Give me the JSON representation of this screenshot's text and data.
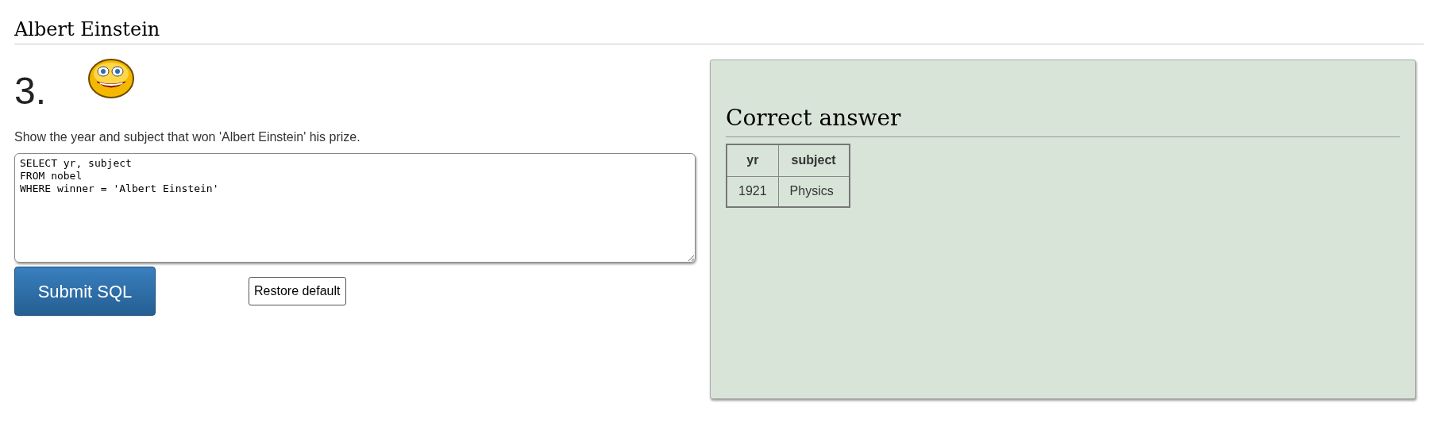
{
  "page_title": "Albert Einstein",
  "question": {
    "number": "3.",
    "text": "Show the year and subject that won 'Albert Einstein' his prize."
  },
  "sql_editor": {
    "value": "SELECT yr, subject\nFROM nobel\nWHERE winner = 'Albert Einstein'"
  },
  "buttons": {
    "submit": "Submit SQL",
    "restore": "Restore default"
  },
  "answer_panel": {
    "heading": "Correct answer",
    "table": {
      "columns": [
        "yr",
        "subject"
      ],
      "rows": [
        [
          "1921",
          "Physics"
        ]
      ]
    }
  }
}
